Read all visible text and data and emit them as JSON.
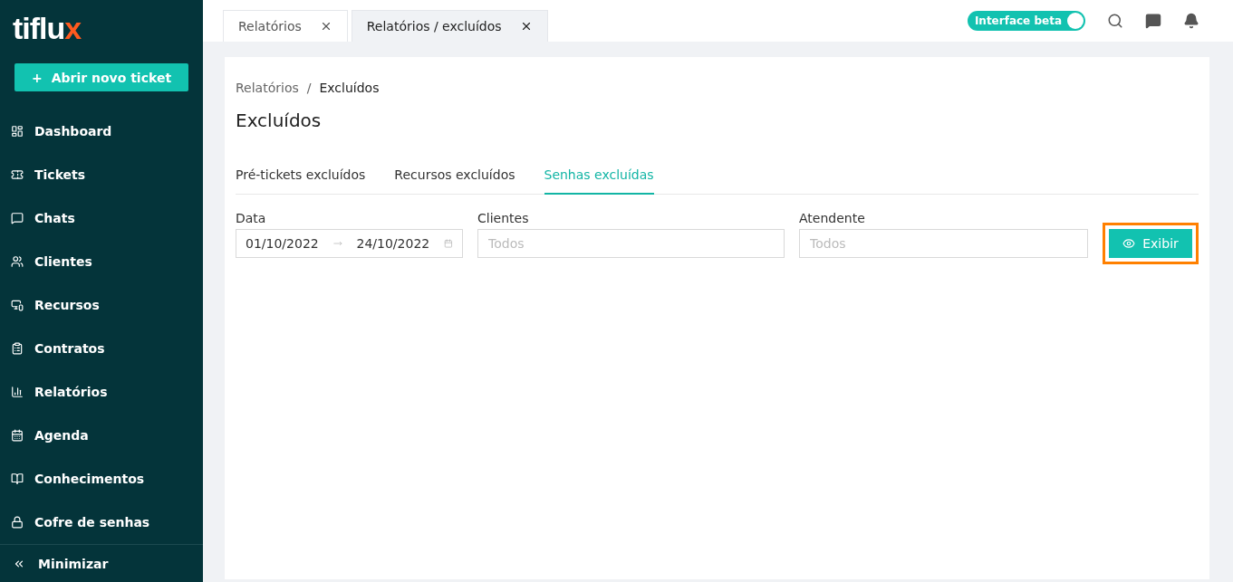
{
  "sidebar": {
    "logo": {
      "main": "tiflu",
      "accent": "x"
    },
    "new_ticket_button": {
      "icon": "+",
      "label": "Abrir novo ticket"
    },
    "items": [
      {
        "label": "Dashboard",
        "kind": "dashboard"
      },
      {
        "label": "Tickets",
        "kind": "ticket"
      },
      {
        "label": "Chats",
        "kind": "chat"
      },
      {
        "label": "Clientes",
        "kind": "users"
      },
      {
        "label": "Recursos",
        "kind": "devices"
      },
      {
        "label": "Contratos",
        "kind": "clipboard"
      },
      {
        "label": "Relatórios",
        "kind": "report"
      },
      {
        "label": "Agenda",
        "kind": "calendar"
      },
      {
        "label": "Conhecimentos",
        "kind": "book"
      },
      {
        "label": "Cofre de senhas",
        "kind": "lock"
      }
    ],
    "minimize": {
      "label": "Minimizar"
    }
  },
  "page_tabs": [
    {
      "label": "Relatórios",
      "selected": false
    },
    {
      "label": "Relatórios / excluídos",
      "selected": true
    }
  ],
  "header": {
    "beta_toggle": {
      "label": "Interface beta",
      "on": true
    }
  },
  "breadcrumb": {
    "separator": "/",
    "items": [
      "Relatórios",
      "Excluídos"
    ]
  },
  "title": "Excluídos",
  "tabs": [
    {
      "label": "Pré-tickets excluídos",
      "selected": false
    },
    {
      "label": "Recursos excluídos",
      "selected": false
    },
    {
      "label": "Senhas excluídas",
      "selected": true
    }
  ],
  "filters": {
    "date": {
      "label": "Data",
      "start": "01/10/2022",
      "end": "24/10/2022"
    },
    "clients": {
      "label": "Clientes",
      "placeholder": "Todos"
    },
    "attendant": {
      "label": "Atendente",
      "placeholder": "Todos"
    },
    "show_button": {
      "label": "Exibir",
      "highlighted": true
    }
  }
}
